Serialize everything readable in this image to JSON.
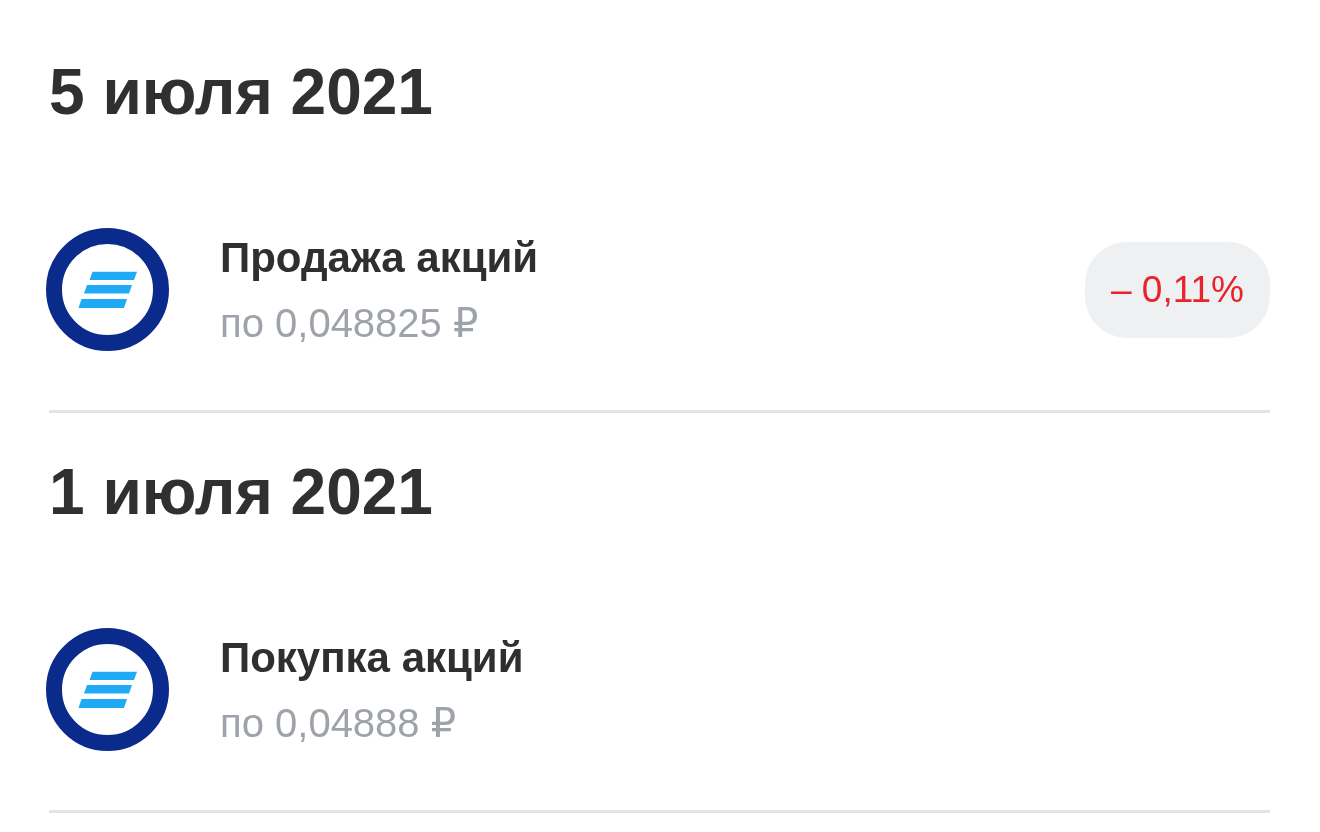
{
  "sections": [
    {
      "date": "5 июля 2021",
      "operations": [
        {
          "title": "Продажа акций",
          "price": "по 0,048825 ₽",
          "change": {
            "text": "– 0,11%",
            "negative": true
          }
        }
      ]
    },
    {
      "date": "1 июля 2021",
      "operations": [
        {
          "title": "Покупка акций",
          "price": "по 0,04888 ₽"
        }
      ]
    }
  ]
}
